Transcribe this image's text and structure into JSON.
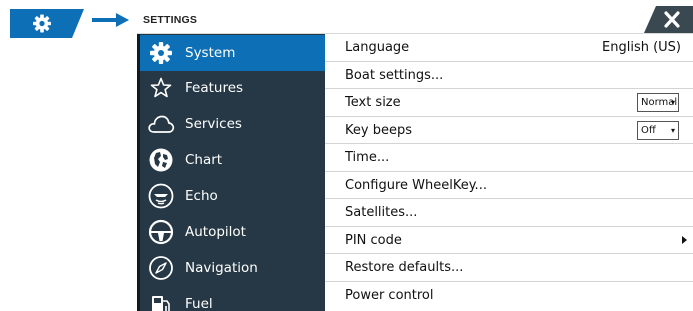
{
  "colors": {
    "accent": "#0d6fb5",
    "sidebar_bg": "#263845",
    "close_bg": "#3a4852"
  },
  "tab": {
    "icon": "gear-icon"
  },
  "header": {
    "title": "SETTINGS",
    "close_icon": "close-icon"
  },
  "sidebar": {
    "items": [
      {
        "label": "System",
        "icon": "gear-icon",
        "active": true
      },
      {
        "label": "Features",
        "icon": "star-icon",
        "active": false
      },
      {
        "label": "Services",
        "icon": "cloud-icon",
        "active": false
      },
      {
        "label": "Chart",
        "icon": "chart-globe-icon",
        "active": false
      },
      {
        "label": "Echo",
        "icon": "echo-sonar-icon",
        "active": false
      },
      {
        "label": "Autopilot",
        "icon": "steering-wheel-icon",
        "active": false
      },
      {
        "label": "Navigation",
        "icon": "compass-icon",
        "active": false
      },
      {
        "label": "Fuel",
        "icon": "fuel-pump-icon",
        "active": false
      }
    ]
  },
  "settings": {
    "rows": [
      {
        "label": "Language",
        "value": "English (US)"
      },
      {
        "label": "Boat settings..."
      },
      {
        "label": "Text size",
        "dropdown": "Normal"
      },
      {
        "label": "Key beeps",
        "dropdown": "Off"
      },
      {
        "label": "Time..."
      },
      {
        "label": "Configure WheelKey..."
      },
      {
        "label": "Satellites..."
      },
      {
        "label": "PIN code",
        "chevron": true
      },
      {
        "label": "Restore defaults..."
      },
      {
        "label": "Power control"
      }
    ]
  }
}
